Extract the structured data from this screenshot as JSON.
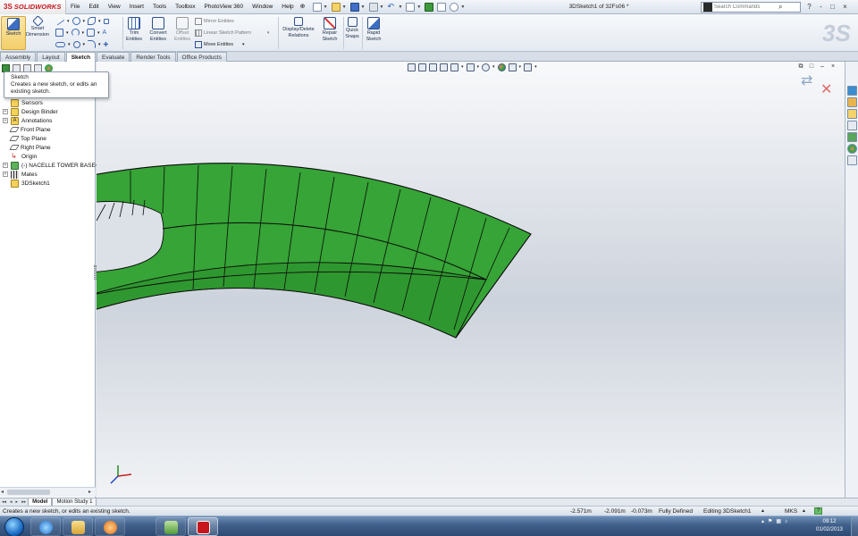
{
  "app": {
    "brand": "SOLIDWORKS",
    "brand_mark": "3S",
    "document_title": "3DSketch1 of 32Fs06 *",
    "menu": [
      "File",
      "Edit",
      "View",
      "Insert",
      "Tools",
      "Toolbox",
      "PhotoView 360",
      "Window",
      "Help"
    ],
    "search_placeholder": "Search Commands",
    "window_controls": [
      "?",
      "-",
      "□",
      "×"
    ]
  },
  "command_manager": {
    "sketch": "Sketch",
    "smart_dimension": "Smart Dimension",
    "trim_entities": "Trim Entities",
    "convert_entities": "Convert Entities",
    "offset_entities": "Offset Entities",
    "mirror_entities": "Mirror Entities",
    "linear_sketch_pattern": "Linear Sketch Pattern",
    "move_entities": "Move Entities",
    "display_delete_relations": "Display/Delete Relations",
    "repair_sketch": "Repair Sketch",
    "quick_snaps": "Quick Snaps",
    "rapid_sketch": "Rapid Sketch"
  },
  "tabs": [
    "Assembly",
    "Layout",
    "Sketch",
    "Evaluate",
    "Render Tools",
    "Office Products"
  ],
  "active_tab": "Sketch",
  "tooltip": {
    "title": "Sketch",
    "description": "Creates a new sketch, or edits an existing sketch."
  },
  "feature_tree": [
    {
      "label": "Sensors",
      "icon": "sensor-icon"
    },
    {
      "label": "Design Binder",
      "icon": "design-binder-icon"
    },
    {
      "label": "Annotations",
      "icon": "annotations-icon"
    },
    {
      "label": "Front Plane",
      "icon": "plane-icon"
    },
    {
      "label": "Top Plane",
      "icon": "plane-icon"
    },
    {
      "label": "Right Plane",
      "icon": "plane-icon"
    },
    {
      "label": "Origin",
      "icon": "origin-icon"
    },
    {
      "label": "(-) NACELLE TOWER BASE<",
      "icon": "part-icon"
    },
    {
      "label": "Mates",
      "icon": "mates-icon"
    },
    {
      "label": "3DSketch1",
      "icon": "sketch3d-icon"
    }
  ],
  "bottom_tabs": [
    "Model",
    "Motion Study 1"
  ],
  "status": {
    "message": "Creates a new sketch, or edits an existing sketch.",
    "x": "-2.571m",
    "y": "-2.091m",
    "z": "-0.073m",
    "defined": "Fully Defined",
    "editing": "Editing 3DSketch1",
    "units": "MKS",
    "help": "?"
  },
  "taskbar": {
    "time": "09:12",
    "date": "01/02/2013"
  },
  "colors": {
    "model_fill": "#36a436",
    "model_edge": "#0b0b0b",
    "accent": "#c8161d"
  }
}
